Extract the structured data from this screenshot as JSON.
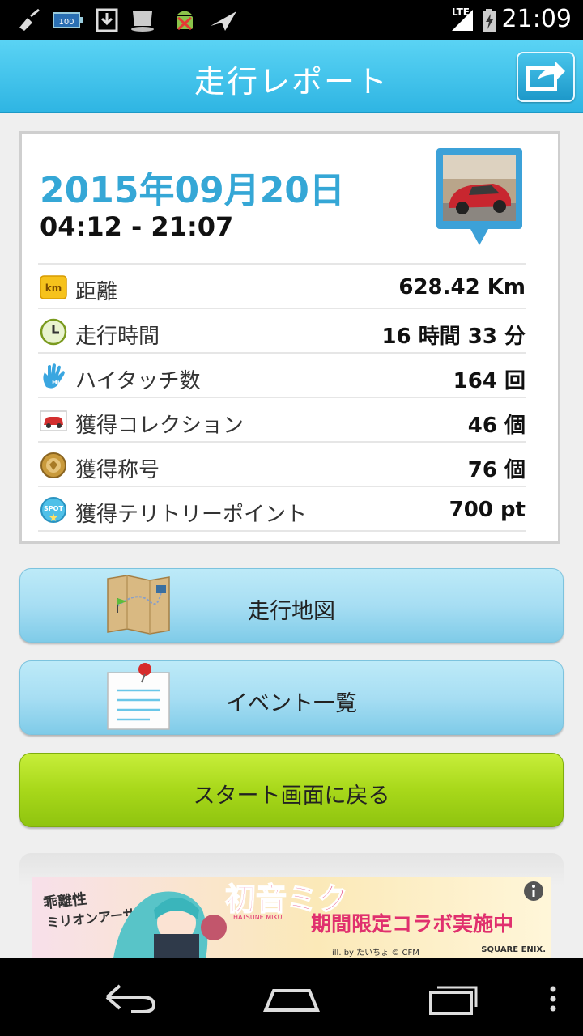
{
  "status_bar": {
    "time": "21:09",
    "network": "LTE",
    "icons": [
      "broom-icon",
      "battery-saver-icon",
      "download-icon",
      "cup-icon",
      "android-icon",
      "paper-plane-icon",
      "signal-icon",
      "battery-icon"
    ]
  },
  "header": {
    "title": "走行レポート",
    "share_icon": "share-icon"
  },
  "report": {
    "date": "2015年09月20日",
    "time_range": "04:12 - 21:07",
    "stats": [
      {
        "icon": "km-icon",
        "label": "距離",
        "value": "628.42 Km"
      },
      {
        "icon": "clock-icon",
        "label": "走行時間",
        "value": "16 時間 33 分"
      },
      {
        "icon": "hand-icon",
        "label": "ハイタッチ数",
        "value": "164 回"
      },
      {
        "icon": "car-icon",
        "label": "獲得コレクション",
        "value": "46 個"
      },
      {
        "icon": "medal-icon",
        "label": "獲得称号",
        "value": "76 個"
      },
      {
        "icon": "spot-icon",
        "label": "獲得テリトリーポイント",
        "value": "700 pt"
      }
    ]
  },
  "buttons": {
    "map": "走行地図",
    "events": "イベント一覧",
    "back": "スタート画面に戻る"
  },
  "ad": {
    "headline": "期間限定コラボ実施中",
    "credit": "ill. by たいちょ © CFM",
    "brand": "SQUARE ENIX."
  },
  "colors": {
    "header": "#2fb5e3",
    "date": "#35a7d6",
    "blue_button": "#a7def3",
    "green_button": "#a8d81a"
  }
}
